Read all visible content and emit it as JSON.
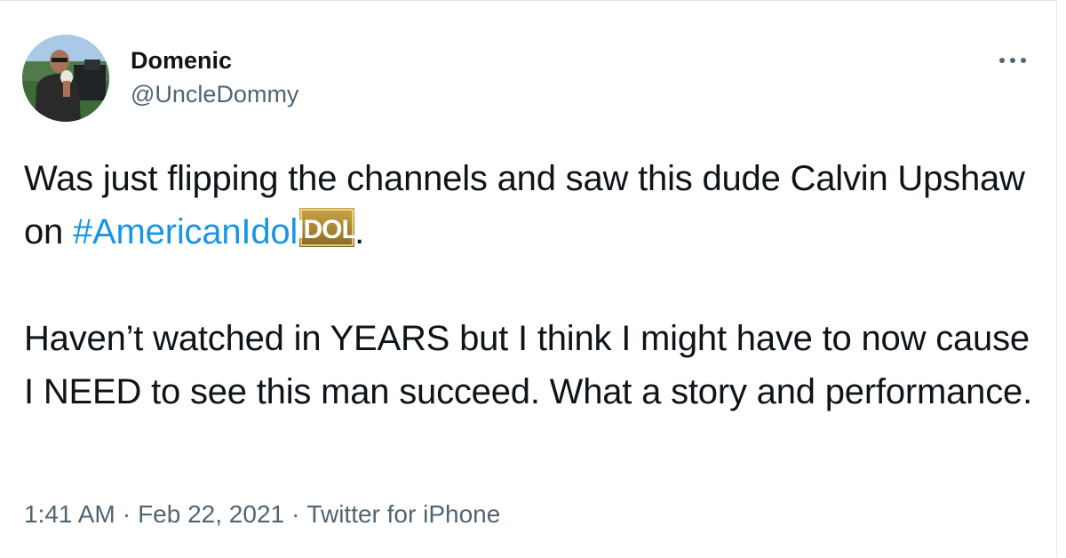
{
  "author": {
    "display_name": "Domenic",
    "username": "@UncleDommy",
    "avatar_icon": "avatar-photo"
  },
  "more_icon": "ellipsis-icon",
  "tweet": {
    "line1_prefix": "Was just flipping the channels and saw this dude Calvin Upshaw on ",
    "hashtag": "#AmericanIdol",
    "emoji_label": "IDOL",
    "line1_suffix": ".",
    "paragraph2": "Haven’t watched in YEARS but I think I might have to now cause I NEED to see this man succeed. What a story and performance."
  },
  "meta": {
    "time": "1:41 AM",
    "separator": "·",
    "date": "Feb 22, 2021",
    "source": "Twitter for iPhone"
  },
  "colors": {
    "link": "#1b95e0",
    "secondary_text": "#536471",
    "emoji_gold": "#a17f2a"
  }
}
